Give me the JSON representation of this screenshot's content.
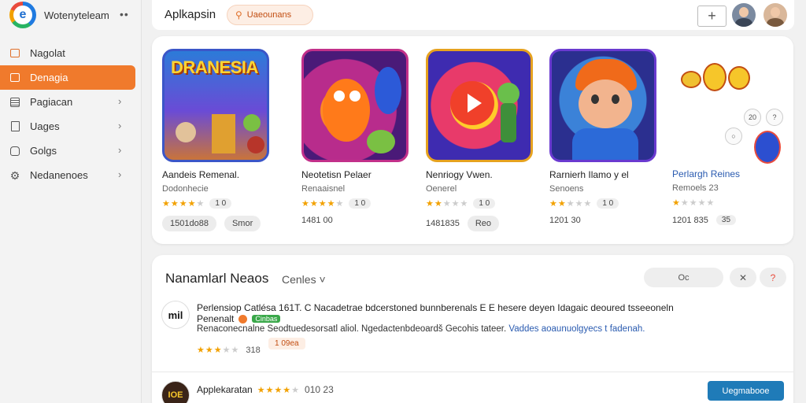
{
  "sidebar": {
    "brand_letter": "e",
    "brand_name": "Wotenyteleam",
    "more_glyph": "••",
    "items": [
      {
        "label": "Nagolat",
        "icon": "box-icon",
        "active": false,
        "chevron": false
      },
      {
        "label": "Denagia",
        "icon": "box-icon",
        "active": true,
        "chevron": false
      },
      {
        "label": "Pagiacan",
        "icon": "list-icon",
        "active": false,
        "chevron": true
      },
      {
        "label": "Uages",
        "icon": "doc-icon",
        "active": false,
        "chevron": true
      },
      {
        "label": "Golgs",
        "icon": "bag-icon",
        "active": false,
        "chevron": true
      },
      {
        "label": "Nedanenoes",
        "icon": "gear-icon",
        "active": false,
        "chevron": true
      }
    ],
    "chevron_glyph": "›"
  },
  "topbar": {
    "title": "Aplkapsin",
    "search_label": "Uaeounans",
    "plus_glyph": "+"
  },
  "featured": {
    "apps": [
      {
        "icon_title": "DRANESIA",
        "name": "Aandeis Remenal.",
        "sub": "Dodonhecie",
        "rating": 4,
        "chip": "1 0",
        "meta1": "1501do88",
        "meta2": "Smor"
      },
      {
        "icon_title": "",
        "name": "Neotetisn Pelaer",
        "sub": "Renaaisnel",
        "rating": 4,
        "chip": "1 0",
        "meta1": "1481 00",
        "meta2": ""
      },
      {
        "icon_title": "",
        "name": "Nenriogy Vwen.",
        "sub": "Oenerel",
        "rating": 2,
        "chip": "1 0",
        "meta1": "1481835",
        "meta2": "Reo"
      },
      {
        "icon_title": "",
        "name": "Rarnierh Ilamo y el",
        "sub": "Senoens",
        "rating": 2,
        "chip": "1 0",
        "meta1": "1201 30",
        "meta2": ""
      },
      {
        "icon_title": "",
        "name": "Perlargh Reines",
        "sub": "Remoels 23",
        "rating": 1,
        "chip": "",
        "meta1": "1201 835",
        "meta2": "35"
      }
    ],
    "mini_buttons": [
      "20",
      "?",
      "○"
    ]
  },
  "list": {
    "title": "Nanamlarl Neaos",
    "filter": "Cenles ˅",
    "search_label": "Oc",
    "btn_x": "✕",
    "btn_q": "?",
    "rows": [
      {
        "avatar": "mil",
        "line1": "Perlensiop Catlésa 161T.  C Nacadetrae bdcerstoned bunnberenals E E hesere deyen Idagaic deoured tsseeoneln",
        "line2": "Penenalt",
        "badge": "Cinbas",
        "line3": "Renaconecnalne Seodtuedesorsatl aliol.  Ngedactenbdeoardš Gecohis tateer.",
        "line3_link": "Vaddes aoaunuolgyecs t fadenah.",
        "rating": 3,
        "count": "318",
        "chip": "1 09ea"
      },
      {
        "avatar": "IOE",
        "line1": "Applekaratan",
        "line1_rating": 4,
        "line1_tail": "010  23",
        "install": "Uegmabooe"
      }
    ]
  },
  "colors": {
    "accent": "#f07a2c",
    "star": "#f2a100",
    "link": "#2a5bb0",
    "install": "#1f7bb8"
  }
}
